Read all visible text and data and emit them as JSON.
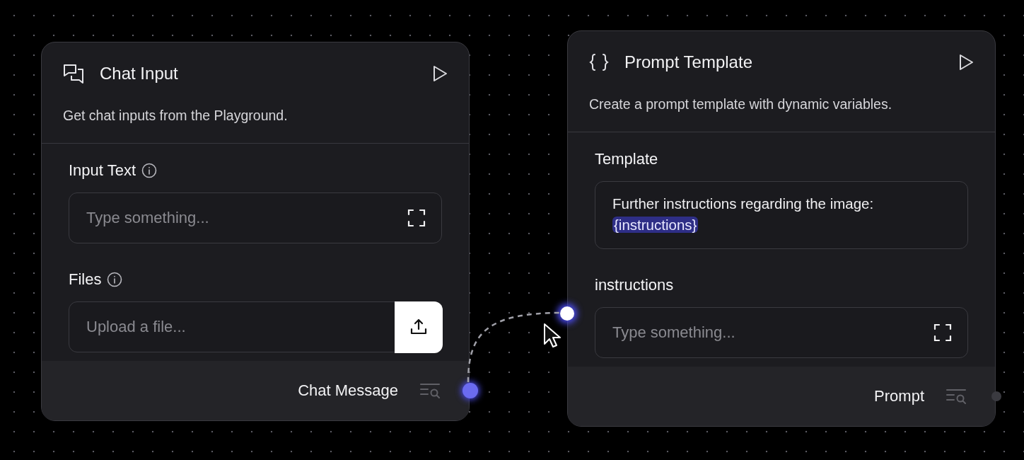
{
  "nodes": [
    {
      "title": "Chat Input",
      "description": "Get chat inputs from the Playground.",
      "fields": [
        {
          "kind": "text",
          "label": "Input Text",
          "info": true,
          "placeholder": "Type something...",
          "handle": false
        },
        {
          "kind": "file",
          "label": "Files",
          "info": true,
          "placeholder": "Upload a file...",
          "handle": false
        }
      ],
      "output": {
        "label": "Chat Message",
        "connected": true
      }
    },
    {
      "title": "Prompt Template",
      "description": "Create a prompt template with dynamic variables.",
      "fields": [
        {
          "kind": "template",
          "label": "Template",
          "info": false,
          "parts": [
            {
              "text": "Further instructions regarding the image: ",
              "variable": false
            },
            {
              "text": "{instructions}",
              "variable": true
            }
          ],
          "handle": false
        },
        {
          "kind": "text",
          "label": "instructions",
          "info": false,
          "placeholder": "Type something...",
          "handle": true
        }
      ],
      "output": {
        "label": "Prompt",
        "connected": false
      }
    }
  ]
}
